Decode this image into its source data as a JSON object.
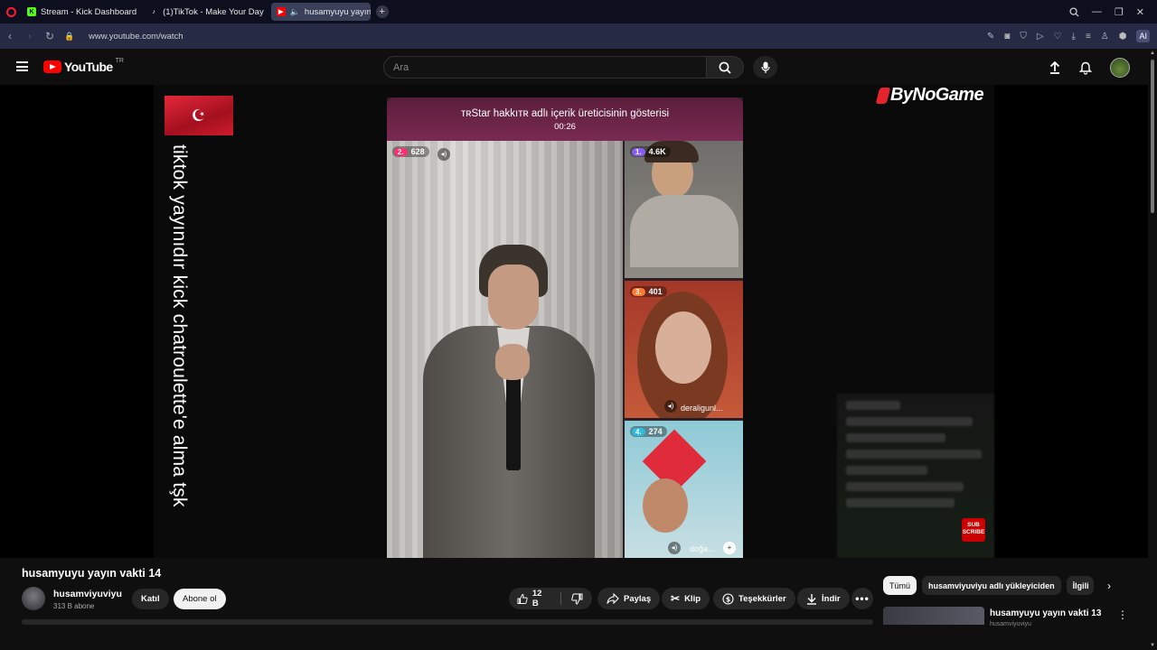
{
  "browser": {
    "tabs": [
      {
        "label": "Stream - Kick Dashboard",
        "fav_color": "#53fc18",
        "fav_char": "K"
      },
      {
        "label": "(1)TikTok - Make Your Day",
        "fav_color": "#000000",
        "fav_char": "♪"
      },
      {
        "label": "husamyuyu yayın vakt",
        "fav_color": "#ff0000",
        "fav_char": "▶"
      }
    ],
    "url": "www.youtube.com/watch",
    "ai_label": "AI"
  },
  "youtube": {
    "logo_text": "YouTube",
    "country_code": "TR",
    "search_placeholder": "Ara",
    "accent": "#ff0000"
  },
  "video": {
    "vertical_overlay_text": "tiktok yayınıdır kick chatroulette'e alma tşk",
    "watermark": "ByNoGame",
    "subscribe_label": "SUB SCRIBE",
    "tiktok": {
      "banner_title": "ᴛʀStar hakkıᴛʀ adlı içerik üreticisinin gösterisi",
      "timer": "00:26",
      "participants": [
        {
          "rank": "2.",
          "score": "628",
          "rank_color": "#ff2d6f"
        },
        {
          "rank": "1.",
          "score": "4.6K",
          "rank_color": "#8a5cf6"
        },
        {
          "rank": "3.",
          "score": "401",
          "rank_color": "#ff7a2d",
          "name": "deraligunl..."
        },
        {
          "rank": "4.",
          "score": "274",
          "rank_color": "#2dbde0",
          "name": "doğa..."
        }
      ]
    }
  },
  "below": {
    "title": "husamyuyu yayın vakti 14",
    "channel_name": "husamviyuviyu",
    "subscribers": "313 B abone",
    "join_label": "Katıl",
    "subscribe_label": "Abone ol",
    "likes": "12 B",
    "share_label": "Paylaş",
    "clip_label": "Klip",
    "thanks_label": "Teşekkürler",
    "download_label": "İndir"
  },
  "sidebar": {
    "chips": [
      "Tümü",
      "husamviyuviyu adlı yükleyiciden",
      "İlgili"
    ],
    "recommended": {
      "title": "husamyuyu yayın vakti 13",
      "channel": "husamviyuviyu"
    }
  }
}
